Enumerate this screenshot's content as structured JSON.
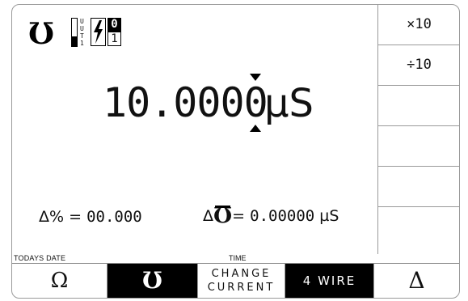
{
  "status": {
    "mode_symbol": "Ʊ",
    "uut_letters": [
      "U",
      "U",
      "T",
      "1"
    ],
    "bolt_icon": "lightning-bolt-icon",
    "range_top": "0",
    "range_bottom": "1"
  },
  "reading": {
    "value_before_cursor": "10.000",
    "cursor_digit": "0",
    "unit": "µS"
  },
  "deviation": {
    "pct_label": "Δ% =",
    "pct_value": "00.000",
    "delta_prefix": "Δ",
    "delta_symbol": "Ʊ",
    "delta_eq": "=",
    "delta_value": "0.00000",
    "delta_unit": "µS"
  },
  "side_keys": [
    {
      "label": "×10"
    },
    {
      "label": "÷10"
    },
    {
      "label": ""
    },
    {
      "label": ""
    },
    {
      "label": ""
    },
    {
      "label": ""
    }
  ],
  "footer": {
    "date_label": "TODAYS DATE",
    "time_label": "TIME"
  },
  "bottom_keys": {
    "ohm": "Ω",
    "mho": "Ʊ",
    "change_current_line1": "CHANGE",
    "change_current_line2": "CURRENT",
    "four_wire": "4 WIRE",
    "delta": "Δ"
  },
  "colors": {
    "background": "#ffffff",
    "foreground": "#000000",
    "border": "#9a9a9a",
    "selected_key_bg": "#000000"
  }
}
